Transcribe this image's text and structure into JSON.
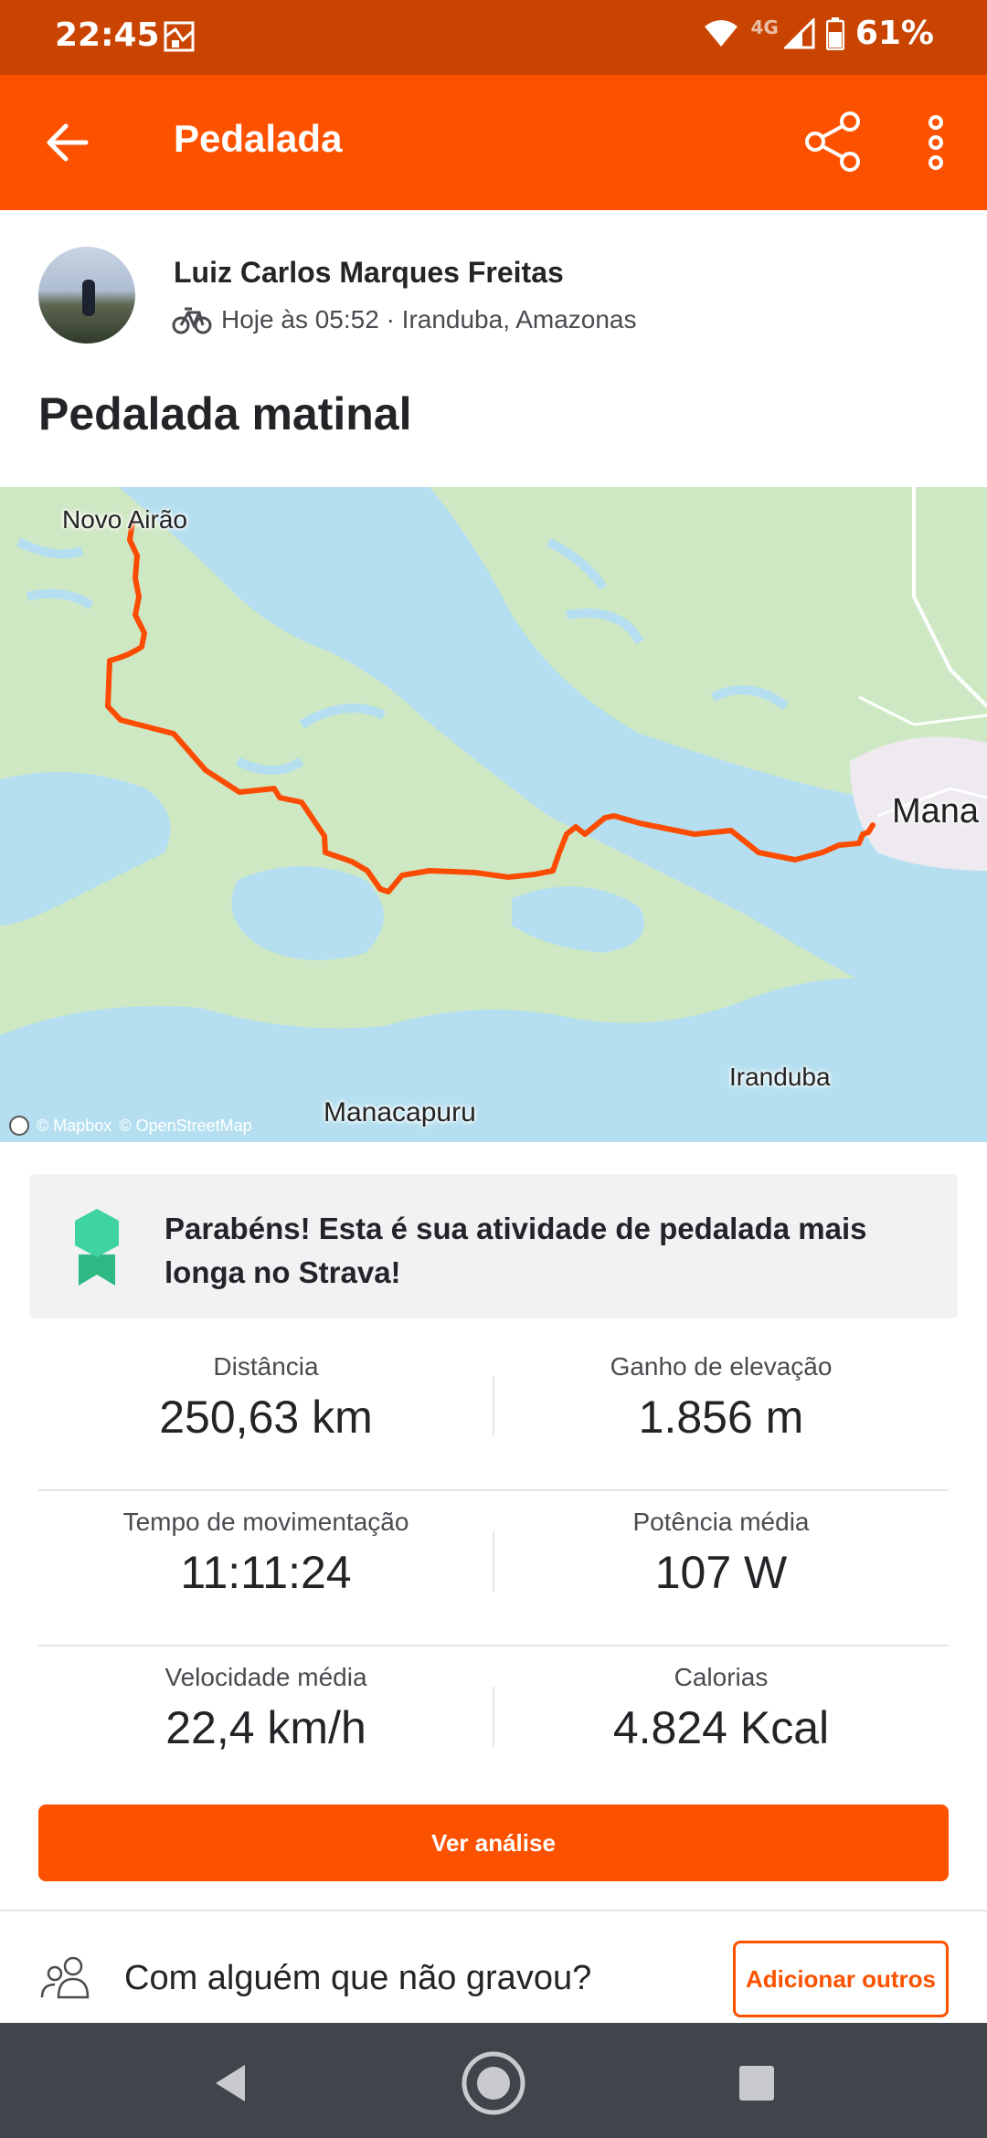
{
  "status_bar": {
    "time": "22:45",
    "network": "4G",
    "battery": "61%"
  },
  "app_bar": {
    "title": "Pedalada"
  },
  "activity": {
    "athlete_name": "Luiz Carlos Marques Freitas",
    "meta": "Hoje às 05:52 · Iranduba, Amazonas",
    "title": "Pedalada matinal"
  },
  "map": {
    "labels": {
      "novo_airao": "Novo Airão",
      "manacapuru": "Manacapuru",
      "iranduba": "Iranduba",
      "manaus": "Mana"
    },
    "attribution_mapbox": "© Mapbox",
    "attribution_osm": "© OpenStreetMap",
    "route_color": "#fc4c02"
  },
  "achievement": {
    "text": "Parabéns! Esta é sua atividade de pedalada mais longa no Strava!"
  },
  "stats": [
    {
      "label": "Distância",
      "value": "250,63 km"
    },
    {
      "label": "Ganho de elevação",
      "value": "1.856 m"
    },
    {
      "label": "Tempo de movimentação",
      "value": "11:11:24"
    },
    {
      "label": "Potência média",
      "value": "107 W"
    },
    {
      "label": "Velocidade média",
      "value": "22,4 km/h"
    },
    {
      "label": "Calorias",
      "value": "4.824 Kcal"
    }
  ],
  "buttons": {
    "analysis": "Ver análise",
    "add_others": "Adicionar outros"
  },
  "prompt": {
    "text": "Com alguém que não gravou?"
  },
  "colors": {
    "brand": "#fc5200",
    "status_bar": "#c94400",
    "water": "#b7e3d0",
    "land": "#cfe8c4"
  },
  "icons": [
    "back-arrow-icon",
    "share-icon",
    "more-vert-icon",
    "bike-icon",
    "medal-icon",
    "people-icon",
    "nav-back-icon",
    "nav-home-icon",
    "nav-recents-icon"
  ]
}
